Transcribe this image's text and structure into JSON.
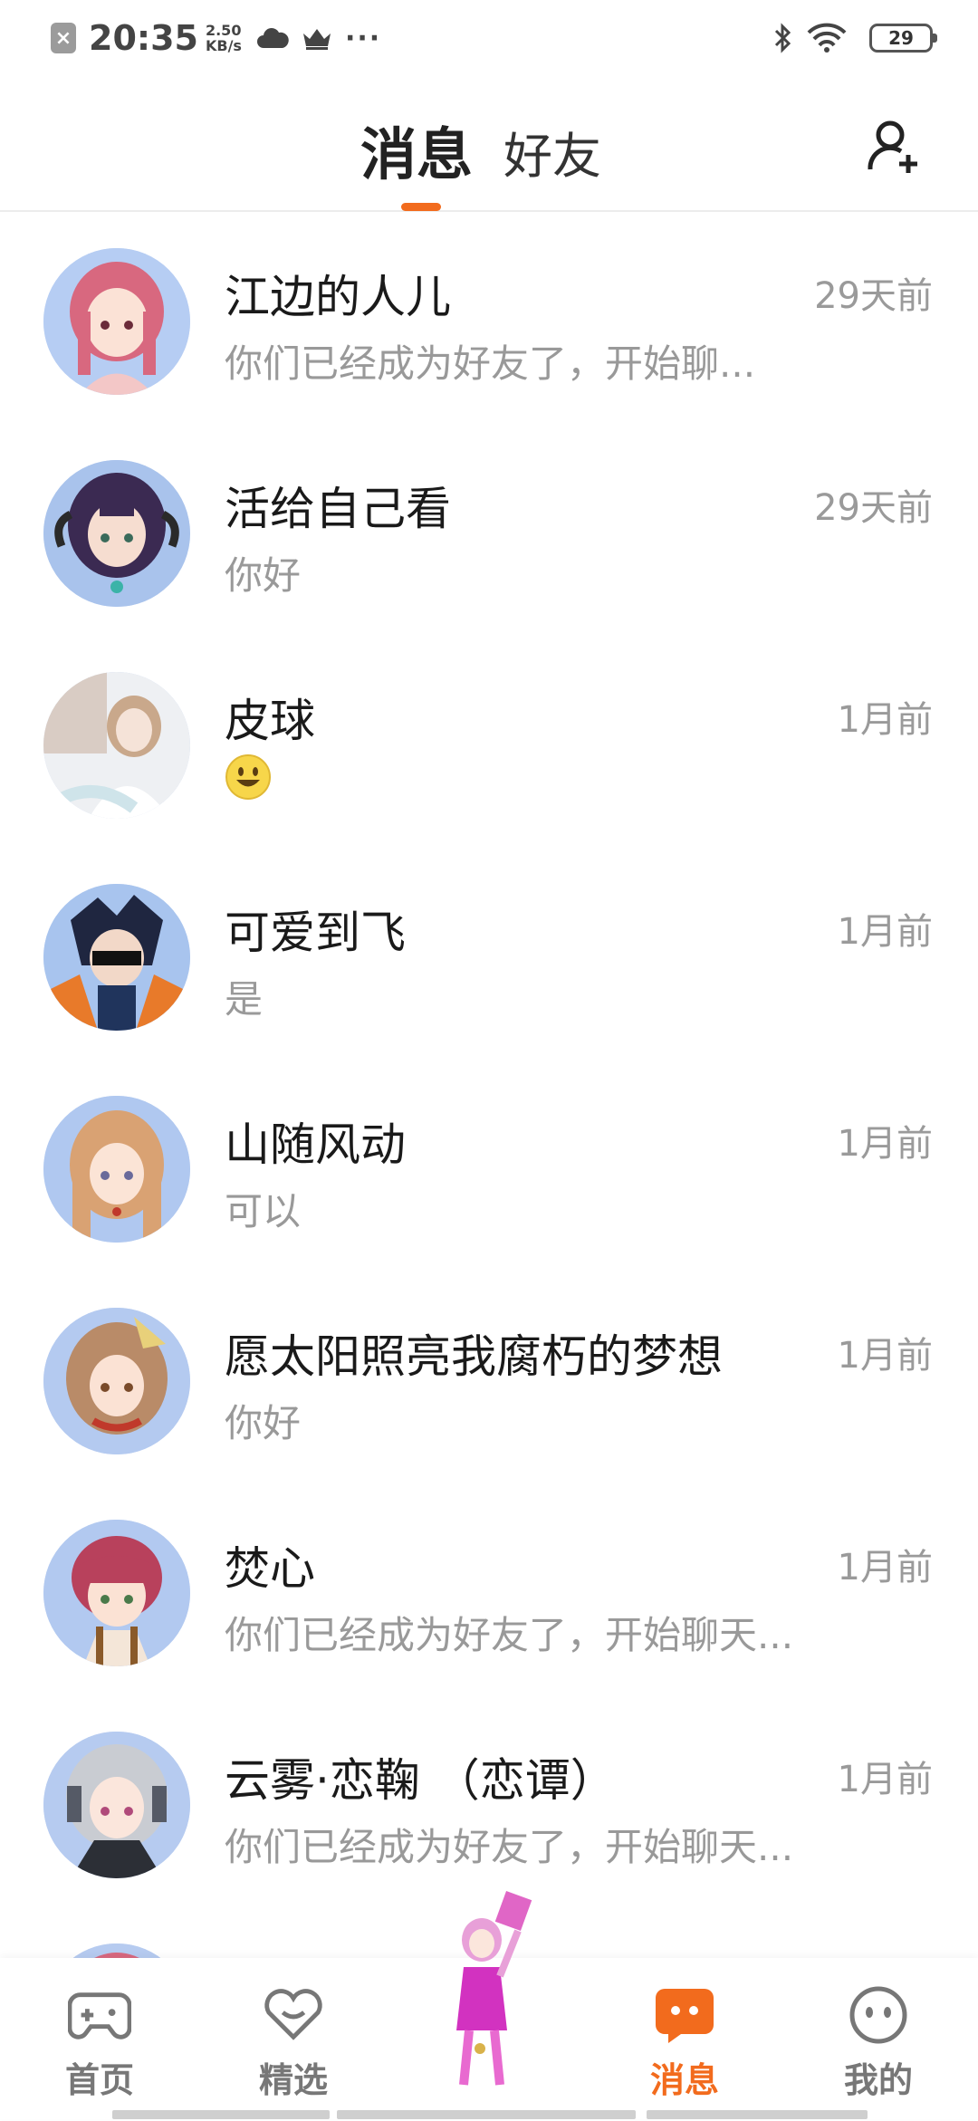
{
  "status_bar": {
    "time": "20:35",
    "speed_value": "2.50",
    "speed_unit": "KB/s",
    "more": "···",
    "battery": "29"
  },
  "header": {
    "tab_messages": "消息",
    "tab_friends": "好友",
    "accent_color": "#f26b1d"
  },
  "messages": [
    {
      "name": "江边的人儿",
      "preview": "你们已经成为好友了，开始聊...",
      "time": "29天前"
    },
    {
      "name": "活给自己看",
      "preview": "你好",
      "time": "29天前"
    },
    {
      "name": "皮球",
      "preview": "",
      "time": "1月前"
    },
    {
      "name": "可爱到飞",
      "preview": "是",
      "time": "1月前"
    },
    {
      "name": "山随风动",
      "preview": "可以",
      "time": "1月前"
    },
    {
      "name": "愿太阳照亮我腐朽的梦想",
      "preview": "你好",
      "time": "1月前"
    },
    {
      "name": "焚心",
      "preview": "你们已经成为好友了，开始聊天...",
      "time": "1月前"
    },
    {
      "name": "云雾·恋鞠 （恋谭）",
      "preview": "你们已经成为好友了，开始聊天...",
      "time": "1月前"
    }
  ],
  "bottom_nav": {
    "home": "首页",
    "featured": "精选",
    "messages": "消息",
    "mine": "我的"
  }
}
